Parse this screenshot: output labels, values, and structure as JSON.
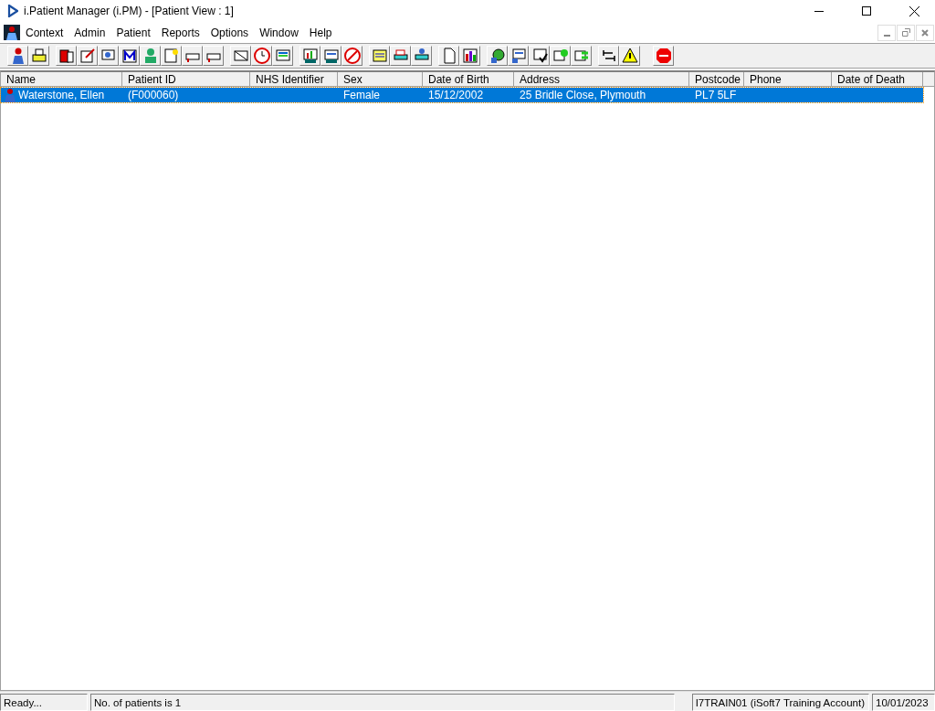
{
  "window": {
    "title": "i.Patient Manager (i.PM) - [Patient View : 1]"
  },
  "menu": [
    "Context",
    "Admin",
    "Patient",
    "Reports",
    "Options",
    "Window",
    "Help"
  ],
  "table": {
    "columns": [
      "Name",
      "Patient ID",
      "NHS Identifier",
      "Sex",
      "Date of Birth",
      "Address",
      "Postcode",
      "Phone",
      "Date of Death"
    ],
    "rows": [
      {
        "selected": true,
        "cells": [
          "Waterstone, Ellen",
          "(F000060)",
          "",
          "Female",
          "15/12/2002",
          "25 Bridle Close, Plymouth",
          "PL7 5LF",
          "",
          ""
        ]
      }
    ]
  },
  "status_bar": [
    "Ready...",
    "No. of patients is 1",
    "I7TRAIN01 (iSoft7 Training Account)",
    "10/01/2023"
  ]
}
